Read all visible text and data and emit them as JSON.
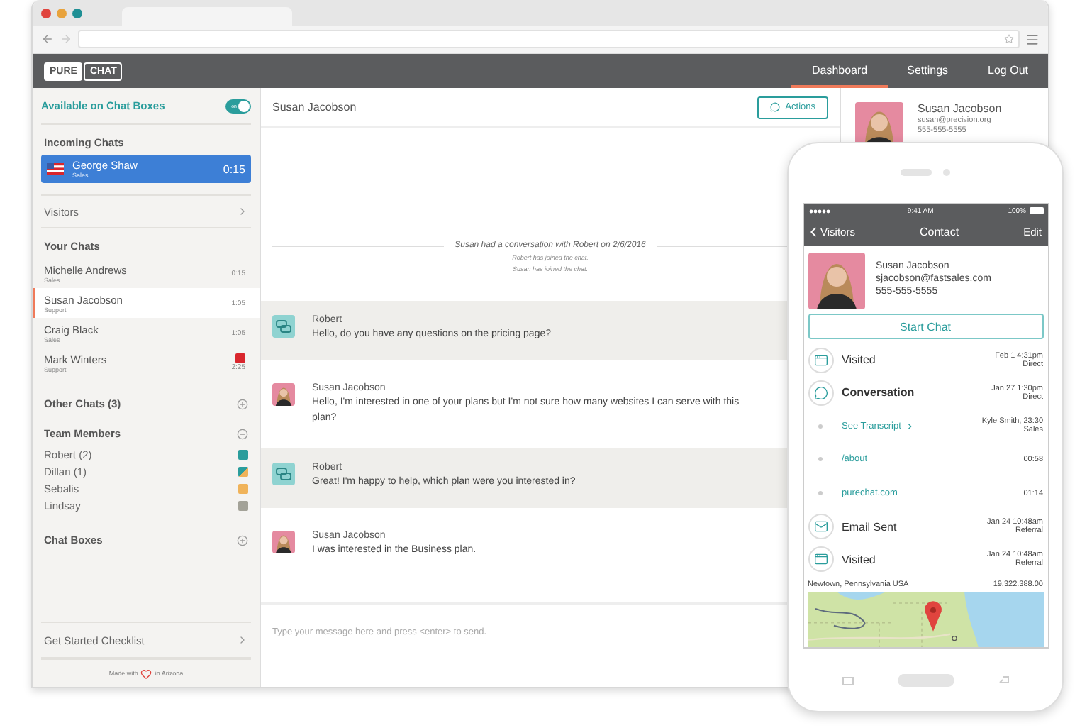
{
  "app": {
    "logo": [
      "PURE",
      "CHAT"
    ],
    "nav": [
      {
        "label": "Dashboard",
        "selected": true
      },
      {
        "label": "Settings",
        "selected": false
      },
      {
        "label": "Log Out",
        "selected": false
      }
    ]
  },
  "sidebar": {
    "availability": {
      "label": "Available on Chat Boxes",
      "toggle_text": "on",
      "on": true
    },
    "incoming": {
      "title": "Incoming Chats",
      "chats": [
        {
          "name": "George Shaw",
          "dept": "Sales",
          "time": "0:15"
        }
      ]
    },
    "visitors": "Visitors",
    "your_chats": {
      "title": "Your Chats",
      "chats": [
        {
          "name": "Michelle Andrews",
          "dept": "Sales",
          "time": "0:15",
          "selected": false,
          "alert": false
        },
        {
          "name": "Susan Jacobson",
          "dept": "Support",
          "time": "1:05",
          "selected": true,
          "alert": false
        },
        {
          "name": "Craig Black",
          "dept": "Sales",
          "time": "1:05",
          "selected": false,
          "alert": false
        },
        {
          "name": "Mark Winters",
          "dept": "Support",
          "time": "2:25",
          "selected": false,
          "alert": true
        }
      ]
    },
    "other_chats": {
      "title": "Other Chats (3)",
      "expanded": false
    },
    "team": {
      "title": "Team Members",
      "expanded": true,
      "members": [
        {
          "name": "Robert (2)",
          "kind": "solid",
          "color": "#2a9d9c"
        },
        {
          "name": "Dillan (1)",
          "kind": "split",
          "color": "#2a9d9c"
        },
        {
          "name": "Sebalis",
          "kind": "solid",
          "color": "#f0b35a"
        },
        {
          "name": "Lindsay",
          "kind": "solid",
          "color": "#a3a298"
        }
      ]
    },
    "chat_boxes": {
      "title": "Chat Boxes",
      "expanded": false
    },
    "checklist": "Get Started Checklist",
    "footer": [
      "Made with",
      "in Arizona"
    ]
  },
  "chat": {
    "title": "Susan Jacobson",
    "actions": "Actions",
    "history": "Susan had a conversation with Robert on 2/6/2016",
    "system": [
      "Robert has joined the chat.",
      "Susan has joined the chat."
    ],
    "messages": [
      {
        "kind": "agent",
        "author": "Robert",
        "text": "Hello, do you have any questions on the pricing page?"
      },
      {
        "kind": "visitor",
        "author": "Susan Jacobson",
        "text": "Hello, I'm interested in one of your plans but I'm not sure how many websites I can serve with this plan?"
      },
      {
        "kind": "agent",
        "author": "Robert",
        "text": "Great! I'm happy to help, which plan were you interested in?"
      },
      {
        "kind": "visitor",
        "author": "Susan Jacobson",
        "text": "I was interested in the Business plan."
      }
    ],
    "composer": {
      "placeholder": "Type your message here and press <enter> to send."
    }
  },
  "profile": {
    "name": "Susan Jacobson",
    "email": "susan@precision.org",
    "phone": "555-555-5555"
  },
  "phone": {
    "time": "9:41 AM",
    "battery": "100%",
    "back": "Visitors",
    "title": "Contact",
    "edit": "Edit",
    "contact": {
      "name": "Susan Jacobson",
      "email": "sjacobson@fastsales.com",
      "phone": "555-555-5555"
    },
    "start": "Start Chat",
    "timeline": [
      {
        "kind": "visit",
        "title": "Visited",
        "meta": [
          "Feb 1 4:31pm",
          "Direct"
        ]
      },
      {
        "kind": "conversation",
        "title": "Conversation",
        "meta": [
          "Jan 27 1:30pm",
          "Direct"
        ]
      },
      {
        "kind": "transcript",
        "title": "See Transcript",
        "meta": [
          "Kyle Smith, 23:30",
          "Sales"
        ]
      },
      {
        "kind": "link",
        "title": "/about",
        "meta": [
          "00:58"
        ]
      },
      {
        "kind": "link",
        "title": "purechat.com",
        "meta": [
          "01:14"
        ]
      },
      {
        "kind": "email",
        "title": "Email Sent",
        "meta": [
          "Jan 24 10:48am",
          "Referral"
        ]
      },
      {
        "kind": "visit",
        "title": "Visited",
        "meta": [
          "Jan 24 10:48am",
          "Referral"
        ]
      }
    ],
    "location": "Newtown, Pennsylvania USA",
    "ip": "19.322.388.00"
  }
}
